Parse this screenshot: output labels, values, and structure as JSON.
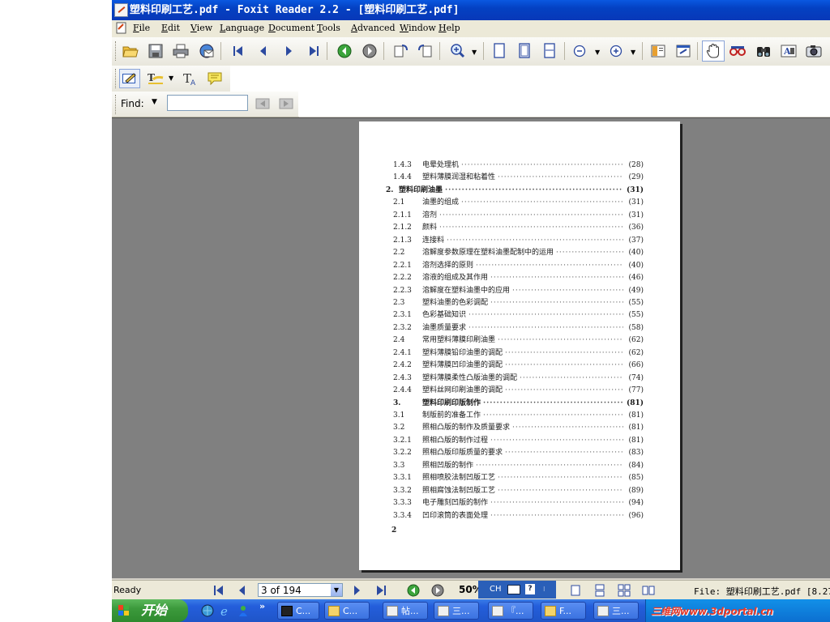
{
  "window": {
    "title": "塑料印刷工艺.pdf - Foxit Reader 2.2 - [塑料印刷工艺.pdf]"
  },
  "menu": [
    "File",
    "Edit",
    "View",
    "Language",
    "Document",
    "Tools",
    "Advanced",
    "Window",
    "Help"
  ],
  "find": {
    "label": "Find:",
    "value": ""
  },
  "document": {
    "toc": [
      {
        "num": "1.4.3",
        "label": "电晕处理机",
        "page": "(28)",
        "bold": false,
        "indent": 1
      },
      {
        "num": "1.4.4",
        "label": "塑料薄膜润湿和粘着性",
        "page": "(29)",
        "bold": false,
        "indent": 1
      },
      {
        "num": "2.",
        "label": "塑料印刷油墨",
        "page": "(31)",
        "bold": true,
        "indent": 0
      },
      {
        "num": "2.1",
        "label": "油墨的组成",
        "page": "(31)",
        "bold": false,
        "indent": 1
      },
      {
        "num": "2.1.1",
        "label": "溶剂",
        "page": "(31)",
        "bold": false,
        "indent": 1
      },
      {
        "num": "2.1.2",
        "label": "颜料",
        "page": "(36)",
        "bold": false,
        "indent": 1
      },
      {
        "num": "2.1.3",
        "label": "连接料",
        "page": "(37)",
        "bold": false,
        "indent": 1
      },
      {
        "num": "2.2",
        "label": "溶解度参数原理在塑料油墨配制中的运用",
        "page": "(40)",
        "bold": false,
        "indent": 1
      },
      {
        "num": "2.2.1",
        "label": "溶剂选择的原则",
        "page": "(40)",
        "bold": false,
        "indent": 1
      },
      {
        "num": "2.2.2",
        "label": "溶液的组成及其作用",
        "page": "(46)",
        "bold": false,
        "indent": 1
      },
      {
        "num": "2.2.3",
        "label": "溶解度在塑料油墨中的应用",
        "page": "(49)",
        "bold": false,
        "indent": 1
      },
      {
        "num": "2.3",
        "label": "塑料油墨的色彩调配",
        "page": "(55)",
        "bold": false,
        "indent": 1
      },
      {
        "num": "2.3.1",
        "label": "色彩基础知识",
        "page": "(55)",
        "bold": false,
        "indent": 1
      },
      {
        "num": "2.3.2",
        "label": "油墨质量要求",
        "page": "(58)",
        "bold": false,
        "indent": 1
      },
      {
        "num": "2.4",
        "label": "常用塑料薄膜印刷油墨",
        "page": "(62)",
        "bold": false,
        "indent": 1
      },
      {
        "num": "2.4.1",
        "label": "塑料薄膜铅印油墨的调配",
        "page": "(62)",
        "bold": false,
        "indent": 1
      },
      {
        "num": "2.4.2",
        "label": "塑料薄膜凹印油墨的调配",
        "page": "(66)",
        "bold": false,
        "indent": 1
      },
      {
        "num": "2.4.3",
        "label": "塑料薄膜柔性凸版油墨的调配",
        "page": "(74)",
        "bold": false,
        "indent": 1
      },
      {
        "num": "2.4.4",
        "label": "塑料丝网印刷油墨的调配",
        "page": "(77)",
        "bold": false,
        "indent": 1
      },
      {
        "num": "3.",
        "label": "塑料印刷印版制作",
        "page": "(81)",
        "bold": true,
        "indent": 1
      },
      {
        "num": "3.1",
        "label": "制版前的准备工作",
        "page": "(81)",
        "bold": false,
        "indent": 1
      },
      {
        "num": "3.2",
        "label": "照相凸版的制作及质量要求",
        "page": "(81)",
        "bold": false,
        "indent": 1
      },
      {
        "num": "3.2.1",
        "label": "照相凸版的制作过程",
        "page": "(81)",
        "bold": false,
        "indent": 1
      },
      {
        "num": "3.2.2",
        "label": "照相凸版印版质量的要求",
        "page": "(83)",
        "bold": false,
        "indent": 1
      },
      {
        "num": "3.3",
        "label": "照相凹版的制作",
        "page": "(84)",
        "bold": false,
        "indent": 1
      },
      {
        "num": "3.3.1",
        "label": "照相喷胶法制凹版工艺",
        "page": "(85)",
        "bold": false,
        "indent": 1
      },
      {
        "num": "3.3.2",
        "label": "照相腐蚀法制凹版工艺",
        "page": "(89)",
        "bold": false,
        "indent": 1
      },
      {
        "num": "3.3.3",
        "label": "电子雕刻凹版的制作",
        "page": "(94)",
        "bold": false,
        "indent": 1
      },
      {
        "num": "3.3.4",
        "label": "凹印滚筒的表面处理",
        "page": "(96)",
        "bold": false,
        "indent": 1
      }
    ],
    "page_footer": "2"
  },
  "status": {
    "ready": "Ready",
    "page_indicator": "3 of 194",
    "zoom": "50%",
    "ime_lang": "CH",
    "file_info": "File: 塑料印刷工艺.pdf [8.27"
  },
  "taskbar": {
    "start_label": "开始",
    "tasks": [
      "C...",
      "C...",
      "帖...",
      "三...",
      "『...",
      "F...",
      "三..."
    ],
    "watermark": "三维网www.3dportal.cn"
  }
}
